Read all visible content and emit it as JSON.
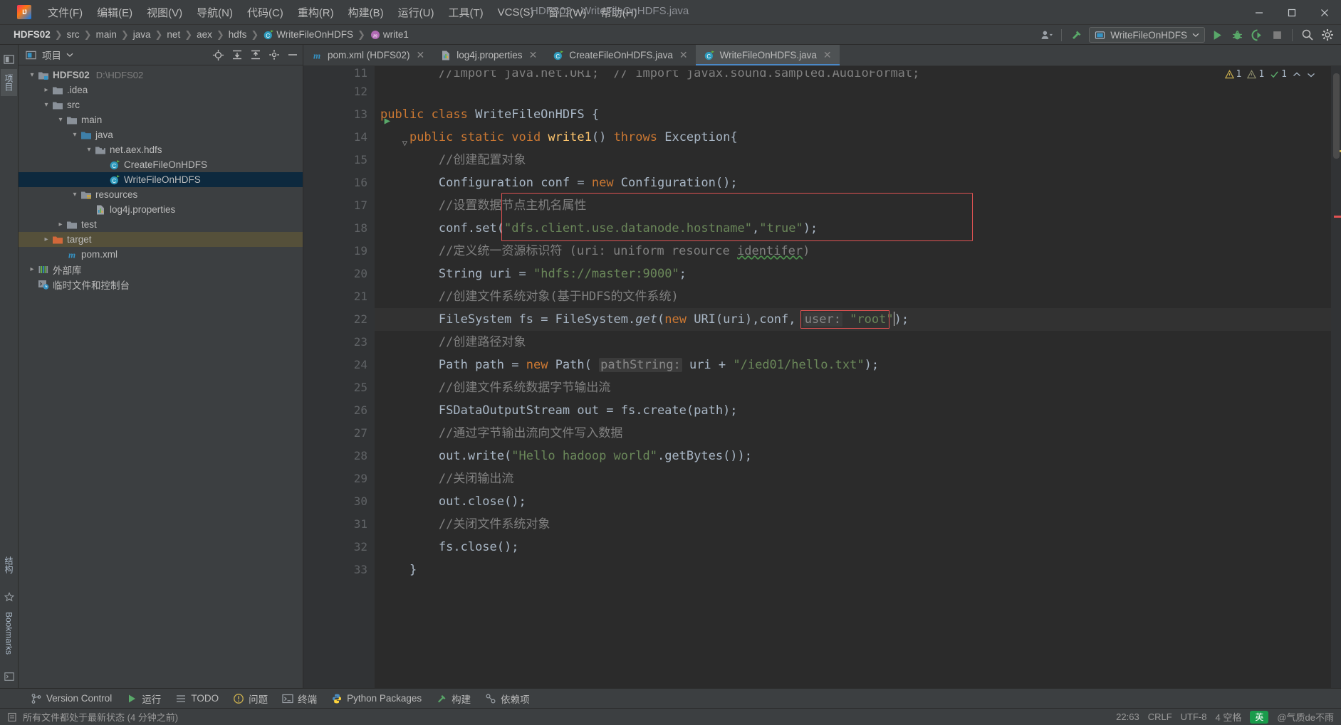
{
  "window": {
    "title": "HDFS02 - WriteFileOnHDFS.java",
    "minimize": "—",
    "maximize": "☐",
    "close": "✕"
  },
  "menu": {
    "items": [
      {
        "label": "文件(F)",
        "name": "menu-file"
      },
      {
        "label": "编辑(E)",
        "name": "menu-edit"
      },
      {
        "label": "视图(V)",
        "name": "menu-view"
      },
      {
        "label": "导航(N)",
        "name": "menu-navigate"
      },
      {
        "label": "代码(C)",
        "name": "menu-code"
      },
      {
        "label": "重构(R)",
        "name": "menu-refactor"
      },
      {
        "label": "构建(B)",
        "name": "menu-build"
      },
      {
        "label": "运行(U)",
        "name": "menu-run"
      },
      {
        "label": "工具(T)",
        "name": "menu-tools"
      },
      {
        "label": "VCS(S)",
        "name": "menu-vcs"
      },
      {
        "label": "窗口(W)",
        "name": "menu-window"
      },
      {
        "label": "帮助(H)",
        "name": "menu-help"
      }
    ]
  },
  "breadcrumbs": [
    {
      "label": "HDFS02",
      "bold": true,
      "icon": null
    },
    {
      "label": "src",
      "bold": false,
      "icon": null
    },
    {
      "label": "main",
      "bold": false,
      "icon": null
    },
    {
      "label": "java",
      "bold": false,
      "icon": null
    },
    {
      "label": "net",
      "bold": false,
      "icon": null
    },
    {
      "label": "aex",
      "bold": false,
      "icon": null
    },
    {
      "label": "hdfs",
      "bold": false,
      "icon": null
    },
    {
      "label": "WriteFileOnHDFS",
      "bold": false,
      "icon": "class-icon"
    },
    {
      "label": "write1",
      "bold": false,
      "icon": "method-icon"
    }
  ],
  "toolbar": {
    "run_config": "WriteFileOnHDFS",
    "run_tooltip": "运行",
    "debug_tooltip": "调试",
    "coverage_tooltip": "运行覆盖率",
    "stop_tooltip": "停止",
    "search_tooltip": "搜索",
    "settings_tooltip": "设置",
    "account_tooltip": "账户",
    "build_tooltip": "构建"
  },
  "project_panel": {
    "title": "项目",
    "tools": [
      "target-icon",
      "collapse-all-icon",
      "expand-icon",
      "gear-icon",
      "hide-icon"
    ],
    "tree": [
      {
        "label": "HDFS02",
        "path": "D:\\HDFS02",
        "depth": 0,
        "arrow": "down",
        "icon": "project-folder",
        "bold": true,
        "state": "normal"
      },
      {
        "label": ".idea",
        "path": "",
        "depth": 1,
        "arrow": "right",
        "icon": "folder",
        "bold": false,
        "state": "normal"
      },
      {
        "label": "src",
        "path": "",
        "depth": 1,
        "arrow": "down",
        "icon": "folder",
        "bold": false,
        "state": "normal"
      },
      {
        "label": "main",
        "path": "",
        "depth": 2,
        "arrow": "down",
        "icon": "folder",
        "bold": false,
        "state": "normal"
      },
      {
        "label": "java",
        "path": "",
        "depth": 3,
        "arrow": "down",
        "icon": "source-folder",
        "bold": false,
        "state": "normal"
      },
      {
        "label": "net.aex.hdfs",
        "path": "",
        "depth": 4,
        "arrow": "down",
        "icon": "package",
        "bold": false,
        "state": "normal"
      },
      {
        "label": "CreateFileOnHDFS",
        "path": "",
        "depth": 5,
        "arrow": "none",
        "icon": "class-icon",
        "bold": false,
        "state": "normal"
      },
      {
        "label": "WriteFileOnHDFS",
        "path": "",
        "depth": 5,
        "arrow": "none",
        "icon": "class-icon",
        "bold": false,
        "state": "selected"
      },
      {
        "label": "resources",
        "path": "",
        "depth": 3,
        "arrow": "down",
        "icon": "resource-folder",
        "bold": false,
        "state": "normal"
      },
      {
        "label": "log4j.properties",
        "path": "",
        "depth": 4,
        "arrow": "none",
        "icon": "properties-file",
        "bold": false,
        "state": "normal"
      },
      {
        "label": "test",
        "path": "",
        "depth": 2,
        "arrow": "right",
        "icon": "folder",
        "bold": false,
        "state": "normal"
      },
      {
        "label": "target",
        "path": "",
        "depth": 1,
        "arrow": "right",
        "icon": "excluded-folder",
        "bold": false,
        "state": "target"
      },
      {
        "label": "pom.xml",
        "path": "",
        "depth": 2,
        "arrow": "none",
        "icon": "maven-file",
        "bold": false,
        "state": "normal"
      },
      {
        "label": "外部库",
        "path": "",
        "depth": 0,
        "arrow": "right",
        "icon": "library",
        "bold": false,
        "state": "normal"
      },
      {
        "label": "临时文件和控制台",
        "path": "",
        "depth": 0,
        "arrow": "none",
        "icon": "scratches",
        "bold": false,
        "state": "normal"
      }
    ]
  },
  "left_tool_window_tabs": [
    {
      "label": "项目",
      "name": "tool-tab-project",
      "selected": true
    },
    {
      "label": "结构",
      "name": "tool-tab-structure",
      "selected": false
    },
    {
      "label": "Bookmarks",
      "name": "tool-tab-bookmarks",
      "selected": false
    }
  ],
  "editor_tabs": [
    {
      "label": "pom.xml (HDFS02)",
      "icon": "maven-file",
      "active": false
    },
    {
      "label": "log4j.properties",
      "icon": "properties-file",
      "active": false
    },
    {
      "label": "CreateFileOnHDFS.java",
      "icon": "class-icon",
      "active": false
    },
    {
      "label": "WriteFileOnHDFS.java",
      "icon": "class-icon",
      "active": true
    }
  ],
  "editor_status": {
    "warnings": "1",
    "weak_warnings": "1",
    "ok_checks": "1"
  },
  "code": {
    "first_visible_line": 11,
    "partial_top_line": "//import java.net.URI;  // import javax.sound.sampled.AudioFormat;",
    "lines": [
      {
        "n": 12,
        "html": ""
      },
      {
        "n": 13,
        "html": "<span class=\"kw\">public class </span><span class=\"ty\">WriteFileOnHDFS </span><span class=\"pl\">{</span>",
        "runmark": true
      },
      {
        "n": 14,
        "html": "    <span class=\"kw\">public static void </span><span class=\"mth\">write1</span><span class=\"pl\">() </span><span class=\"kw\">throws </span><span class=\"ty\">Exception</span><span class=\"pl\">{</span>",
        "fold": true
      },
      {
        "n": 15,
        "html": "        <span class=\"cm\">//创建配置对象</span>"
      },
      {
        "n": 16,
        "html": "        <span class=\"ty\">Configuration </span><span class=\"pl\">conf = </span><span class=\"kw\">new </span><span class=\"ty\">Configuration</span><span class=\"pl\">();</span>"
      },
      {
        "n": 17,
        "html": "        <span class=\"cm\">//设置数据节点主机名属性</span>",
        "boxed": true
      },
      {
        "n": 18,
        "html": "        <span class=\"pl\">conf.set(</span><span class=\"str\">\"dfs.client.use.datanode.hostname\"</span><span class=\"pl\">,</span><span class=\"str\">\"true\"</span><span class=\"pl\">);</span>",
        "boxed": true
      },
      {
        "n": 19,
        "html": "        <span class=\"cm\">//定义统一资源标识符 (uri: uniform resource <span class=\"squiggle\">identifer</span>)</span>"
      },
      {
        "n": 20,
        "html": "        <span class=\"ty\">String </span><span class=\"pl\">uri = </span><span class=\"str\">\"hdfs://master:9000\"</span><span class=\"pl\">;</span>"
      },
      {
        "n": 21,
        "html": "        <span class=\"cm\">//创建文件系统对象(基于HDFS的文件系统)</span>"
      },
      {
        "n": 22,
        "html": "        <span class=\"ty\">FileSystem </span><span class=\"pl\">fs = </span><span class=\"ty\">FileSystem</span><span class=\"pl\">.</span><span class=\"it\">get</span><span class=\"pl\">(</span><span class=\"kw\">new </span><span class=\"ty\">URI</span><span class=\"pl\">(uri),conf, </span>",
        "hint": "user:",
        "hint_value": "\"root\"",
        "tail": "<span class=\"pl\">);</span>",
        "current": true
      },
      {
        "n": 23,
        "html": "        <span class=\"cm\">//创建路径对象</span>"
      },
      {
        "n": 24,
        "html": "        <span class=\"ty\">Path </span><span class=\"pl\">path = </span><span class=\"kw\">new </span><span class=\"ty\">Path</span><span class=\"pl\">( </span><span class=\"hintbox\">pathString:</span><span class=\"pl\"> uri + </span><span class=\"str\">\"/ied01/hello.txt\"</span><span class=\"pl\">);</span>"
      },
      {
        "n": 25,
        "html": "        <span class=\"cm\">//创建文件系统数据字节输出流</span>"
      },
      {
        "n": 26,
        "html": "        <span class=\"ty\">FSDataOutputStream </span><span class=\"pl\">out = fs.create(path);</span>"
      },
      {
        "n": 27,
        "html": "        <span class=\"cm\">//通过字节输出流向文件写入数据</span>"
      },
      {
        "n": 28,
        "html": "        <span class=\"pl\">out.write(</span><span class=\"str\">\"Hello hadoop world\"</span><span class=\"pl\">.getBytes());</span>"
      },
      {
        "n": 29,
        "html": "        <span class=\"cm\">//关闭输出流</span>"
      },
      {
        "n": 30,
        "html": "        <span class=\"pl\">out.close();</span>"
      },
      {
        "n": 31,
        "html": "        <span class=\"cm\">//关闭文件系统对象</span>"
      },
      {
        "n": 32,
        "html": "        <span class=\"pl\">fs.close();</span>"
      },
      {
        "n": 33,
        "html": "    <span class=\"pl\">}</span>",
        "fold_end": true
      }
    ]
  },
  "bottom_bar": {
    "items": [
      {
        "label": "Version Control",
        "icon": "branch-icon",
        "name": "bottom-tab-version-control"
      },
      {
        "label": "运行",
        "icon": "run-icon",
        "name": "bottom-tab-run"
      },
      {
        "label": "TODO",
        "icon": "todo-icon",
        "name": "bottom-tab-todo"
      },
      {
        "label": "问题",
        "icon": "problems-icon",
        "name": "bottom-tab-problems"
      },
      {
        "label": "终端",
        "icon": "terminal-icon",
        "name": "bottom-tab-terminal"
      },
      {
        "label": "Python Packages",
        "icon": "python-icon",
        "name": "bottom-tab-python-packages"
      },
      {
        "label": "构建",
        "icon": "build-icon",
        "name": "bottom-tab-build"
      },
      {
        "label": "依赖项",
        "icon": "deps-icon",
        "name": "bottom-tab-dependencies"
      }
    ]
  },
  "status_bar": {
    "message": "所有文件都处于最新状态 (4 分钟之前)",
    "caret_position": "22:63",
    "line_separator": "CRLF",
    "encoding": "UTF-8",
    "indent": "4 空格",
    "ime_label": "英",
    "watermark": "@气质de不雨"
  },
  "colors": {
    "accent_blue": "#4a88c7",
    "selection": "#0d293e",
    "target_row": "#55503a",
    "red_box": "#e05252",
    "green_run": "#59a869",
    "editor_bg": "#2b2b2b",
    "panel_bg": "#3c3f41",
    "gutter_bg": "#313335"
  }
}
